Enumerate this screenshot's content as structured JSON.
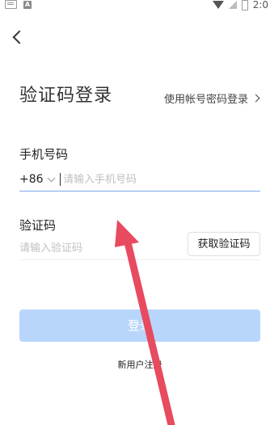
{
  "status_bar": {
    "time": "2:0",
    "left_icons": [
      "keyboard-icon",
      "a-icon"
    ],
    "right_icons": [
      "wifi-icon",
      "signal-icon",
      "battery-icon"
    ],
    "a_letter": "A"
  },
  "header": {
    "back_icon": "chevron-left-icon"
  },
  "main": {
    "title": "验证码登录",
    "alt_login_label": "使用帐号密码登录",
    "phone": {
      "label": "手机号码",
      "country_code": "+86",
      "placeholder": "请输入手机号码",
      "value": ""
    },
    "code": {
      "label": "验证码",
      "placeholder": "请输入验证码",
      "value": "",
      "get_code_label": "获取验证码"
    },
    "login_label": "登录",
    "register_label": "新用户注册"
  },
  "colors": {
    "accent_underline": "#7aa7e6",
    "login_button_disabled": "#b8d6fb",
    "annotation_arrow": "#e84a5f"
  }
}
